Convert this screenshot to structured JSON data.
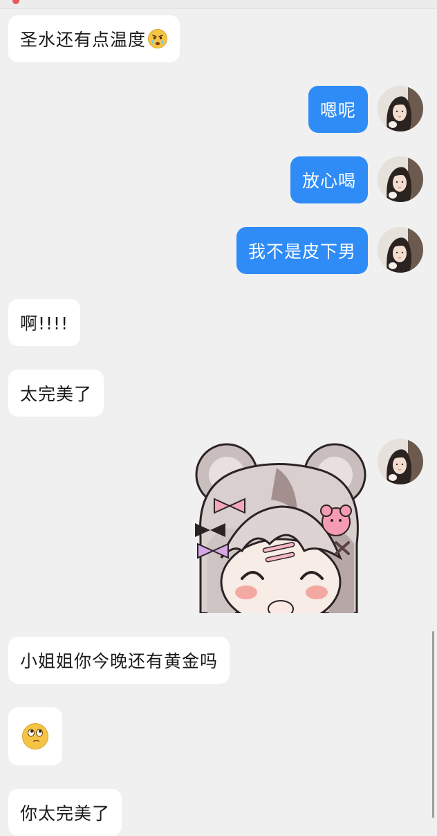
{
  "chat": {
    "messages": [
      {
        "side": "in",
        "text": "圣水还有点温度",
        "emoji": "crying-face-emoji"
      },
      {
        "side": "out",
        "text": "嗯呢"
      },
      {
        "side": "out",
        "text": "放心喝"
      },
      {
        "side": "out",
        "text": "我不是皮下男"
      },
      {
        "side": "in",
        "text": "啊!!!!"
      },
      {
        "side": "in",
        "text": "太完美了"
      },
      {
        "side": "out",
        "type": "sticker",
        "sticker": "bear-girl-sticker"
      },
      {
        "side": "in",
        "text": "小姐姐你今晚还有黄金吗"
      },
      {
        "side": "in",
        "type": "emoji",
        "emoji": "eye-roll-face-emoji"
      },
      {
        "side": "in",
        "text": "你太完美了"
      }
    ]
  },
  "colors": {
    "background": "#f0f0f0",
    "incoming_bubble": "#ffffff",
    "outgoing_bubble": "#2f8cf6",
    "text": "#1a1a1a"
  },
  "icons": {
    "avatar": "user-avatar-photo",
    "emoji_1": "crying-face-emoji",
    "emoji_2": "eye-roll-face-emoji",
    "sticker": "bear-girl-sticker"
  }
}
